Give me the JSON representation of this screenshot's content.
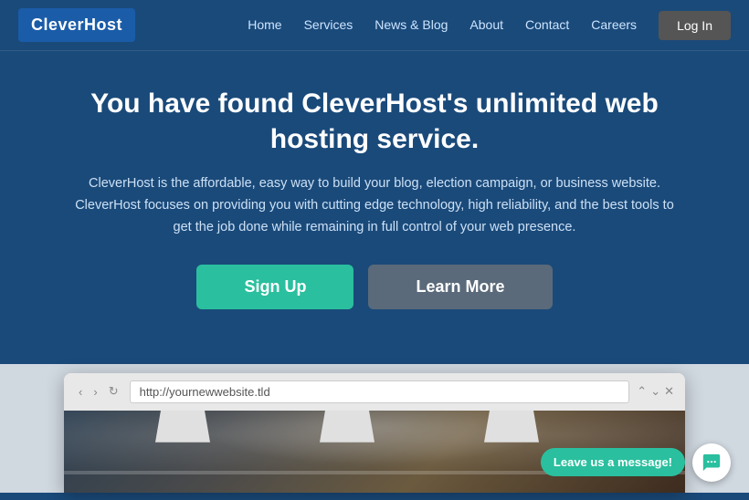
{
  "navbar": {
    "logo": "CleverHost",
    "logo_highlight": "Clever",
    "nav_links": [
      {
        "label": "Home",
        "href": "#"
      },
      {
        "label": "Services",
        "href": "#"
      },
      {
        "label": "News & Blog",
        "href": "#"
      },
      {
        "label": "About",
        "href": "#"
      },
      {
        "label": "Contact",
        "href": "#"
      },
      {
        "label": "Careers",
        "href": "#"
      }
    ],
    "login_label": "Log In"
  },
  "hero": {
    "headline": "You have found CleverHost's unlimited web hosting service.",
    "body": "CleverHost is the affordable, easy way to build your blog, election campaign, or business website. CleverHost focuses on providing you with cutting edge technology, high reliability, and the best tools to get the job done while remaining in full control of your web presence.",
    "signup_label": "Sign Up",
    "learnmore_label": "Learn More"
  },
  "browser": {
    "url": "http://yournewwebsite.tld"
  },
  "chat": {
    "label": "Leave us a message!"
  }
}
